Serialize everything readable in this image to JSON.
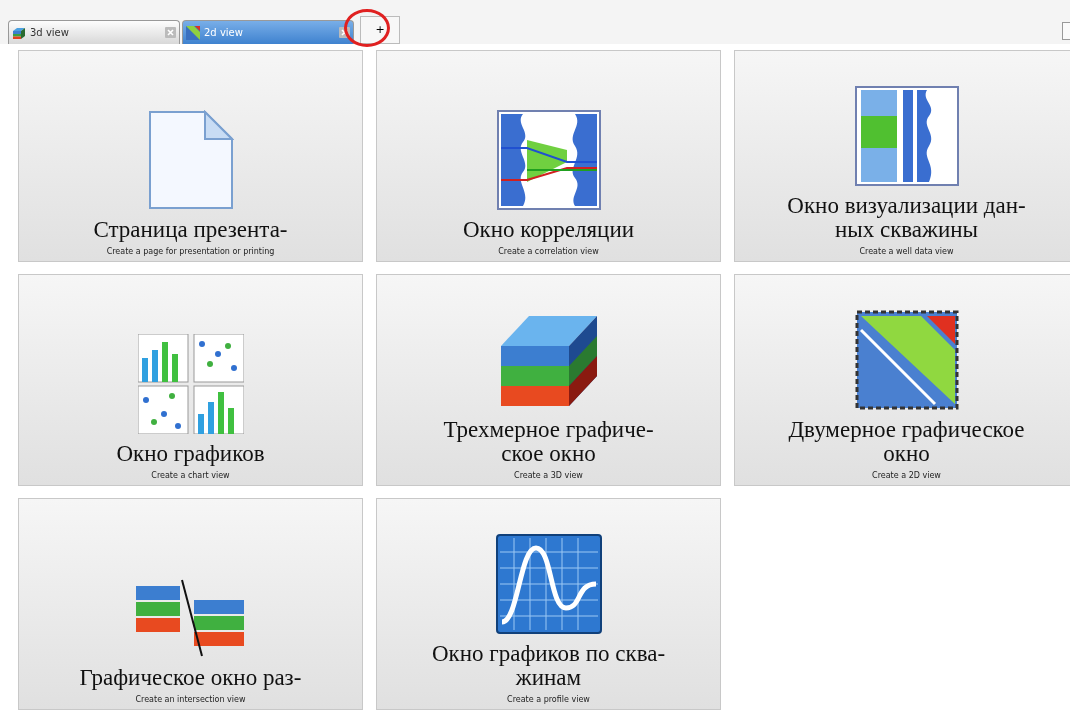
{
  "tabs": [
    {
      "label": "3d view",
      "kind": "cube",
      "selected": false
    },
    {
      "label": "2d view",
      "kind": "map",
      "selected": true
    }
  ],
  "add_tab": {
    "label": "+",
    "highlighted": true
  },
  "tiles": [
    {
      "kind": "page",
      "title": "Страница презента-",
      "subtitle": "Create a page for presentation or printing"
    },
    {
      "kind": "correlation",
      "title": "Окно корреляции",
      "subtitle": "Create a correlation view"
    },
    {
      "kind": "well",
      "title": "Окно визуализации дан-\nных скважины",
      "subtitle": "Create a well data view"
    },
    {
      "kind": "chart",
      "title": "Окно графиков",
      "subtitle": "Create a chart view"
    },
    {
      "kind": "cube",
      "title": "Трехмерное графиче-\nское окно",
      "subtitle": "Create a 3D view"
    },
    {
      "kind": "map",
      "title": "Двумерное графическое\nокно",
      "subtitle": "Create a 2D view"
    },
    {
      "kind": "intersection",
      "title": "Графическое окно раз-",
      "subtitle": "Create an intersection view"
    },
    {
      "kind": "profile",
      "title": "Окно графиков по сква-\nжинам",
      "subtitle": "Create a profile view"
    }
  ]
}
